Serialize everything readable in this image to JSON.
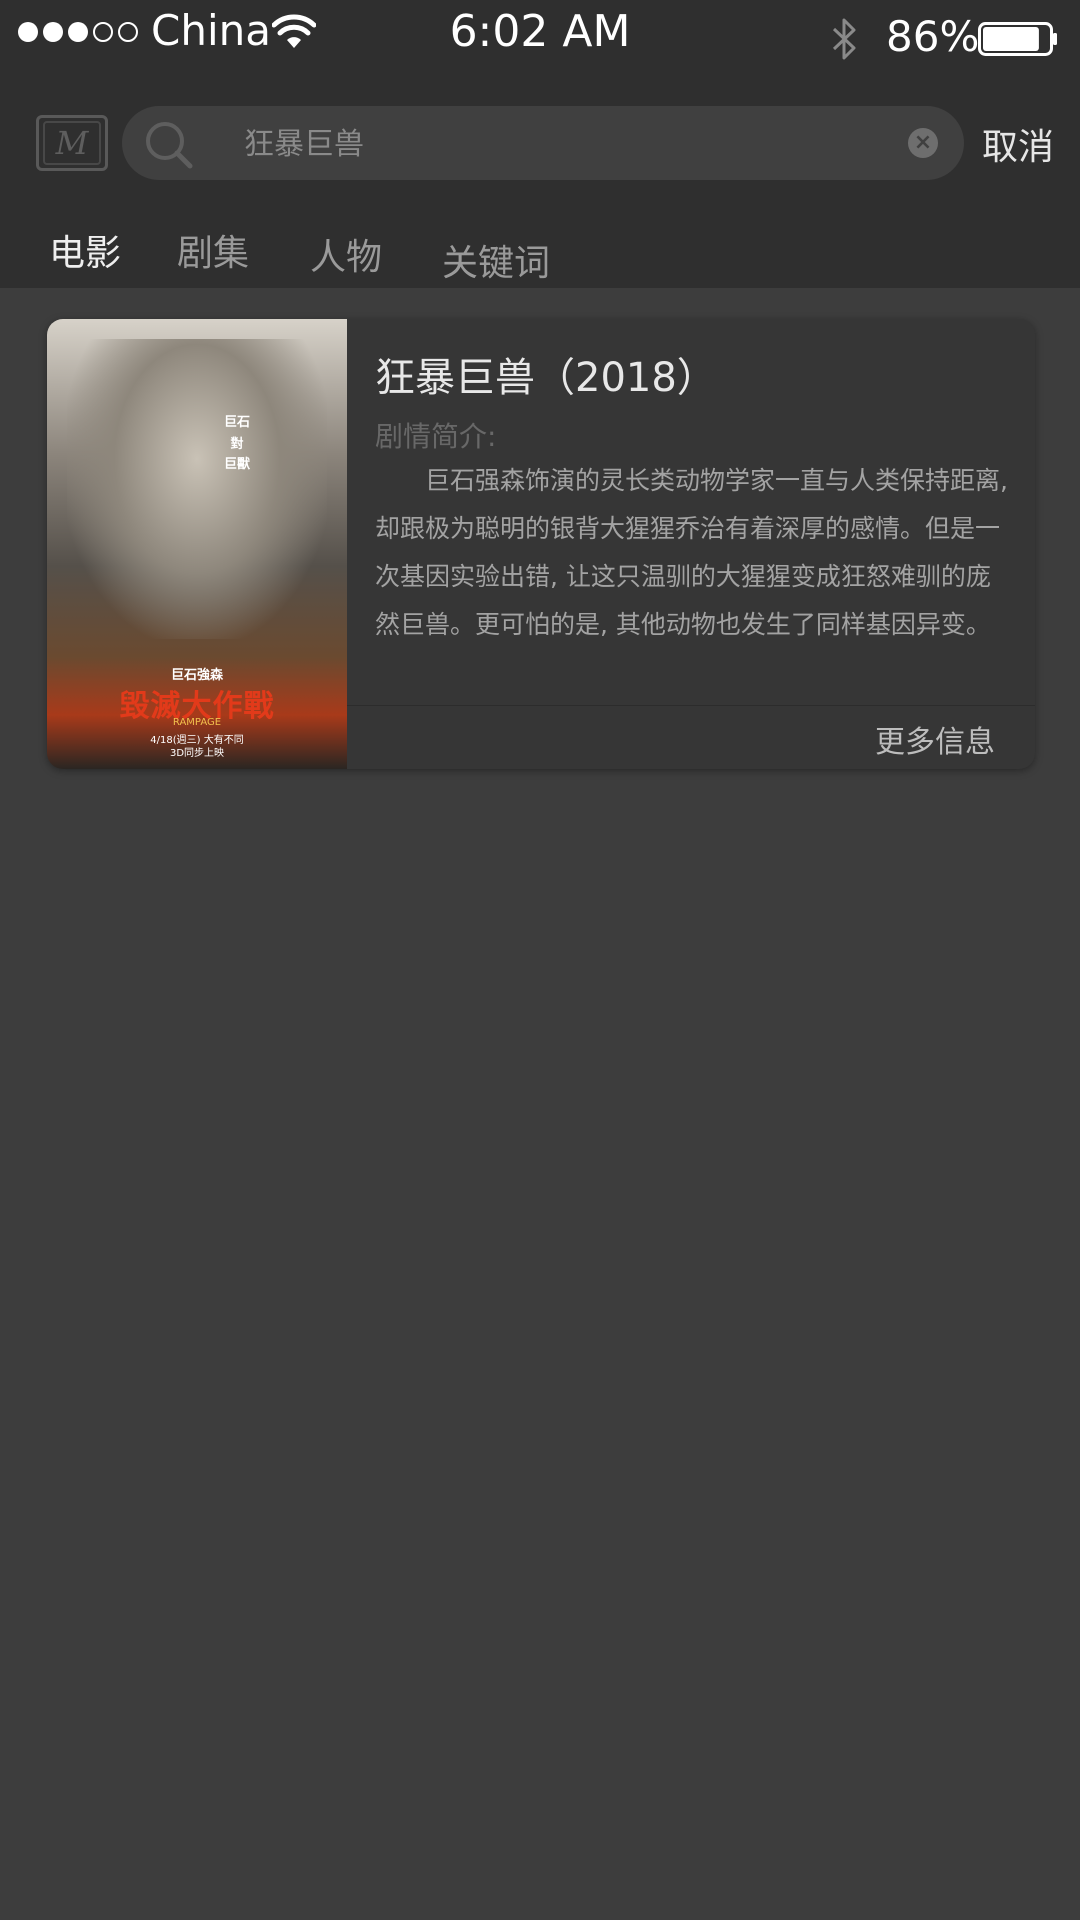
{
  "status_bar": {
    "signal_bars": 3,
    "signal_total": 5,
    "carrier": "China",
    "time": "6:02 AM",
    "battery_percent": "86%",
    "battery_level": 0.86
  },
  "search": {
    "placeholder": "狂暴巨兽",
    "value": "",
    "cancel_label": "取消",
    "logo_letter": "M"
  },
  "tabs": [
    {
      "label": "电影",
      "active": true
    },
    {
      "label": "剧集",
      "active": false
    },
    {
      "label": "人物",
      "active": false
    },
    {
      "label": "关键词",
      "active": false
    }
  ],
  "result": {
    "title": "狂暴巨兽（2018）",
    "synopsis_label": "剧情简介:",
    "synopsis": "巨石强森饰演的灵长类动物学家一直与人类保持距离, 却跟极为聪明的银背大猩猩乔治有着深厚的感情。但是一次基因实验出错, 让这只温驯的大猩猩变成狂怒难驯的庞然巨兽。更可怕的是, 其他动物也发生了同样基因异变。他。。。。。。",
    "more_label": "更多信息",
    "poster": {
      "line1": "巨石",
      "line2": "對",
      "line3": "巨獸",
      "actor": "巨石強森",
      "title": "毀滅大作戰",
      "title_en": "RAMPAGE",
      "date": "4/18(週三) 大有不同",
      "format": "3D同步上映"
    }
  },
  "colors": {
    "background": "#3d3d3d",
    "header": "#2f2f2f",
    "card": "#363636",
    "text_primary": "#e6e6e6",
    "text_secondary": "#a3a3a3"
  }
}
